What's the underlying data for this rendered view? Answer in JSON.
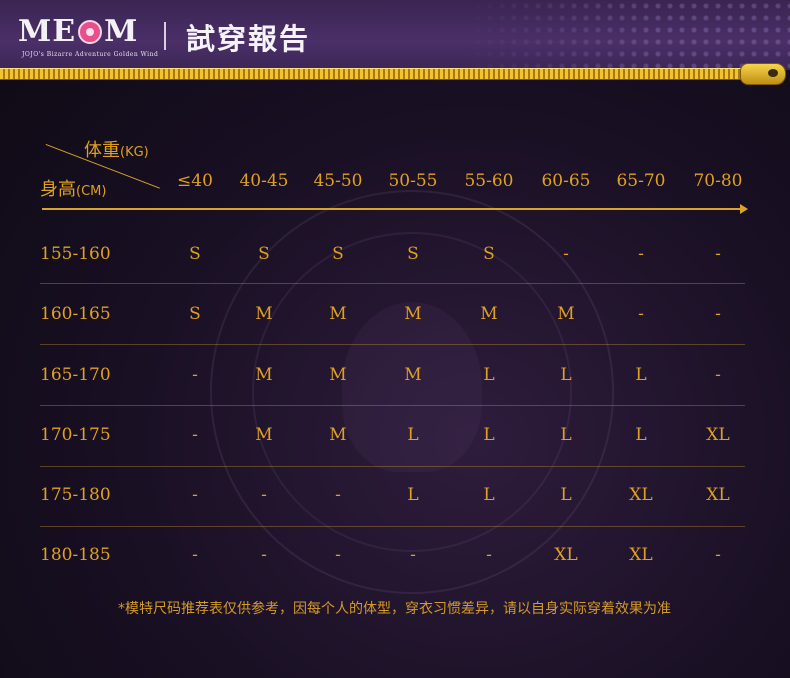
{
  "header": {
    "logo": "MEOM",
    "logo_subtitle": "JOJO's Bizarre Adventure Golden Wind",
    "title": "試穿報告"
  },
  "table": {
    "corner_weight_label": "体重",
    "corner_weight_unit": "(KG)",
    "corner_height_label": "身高",
    "corner_height_unit": "(CM)",
    "columns": [
      "≤40",
      "40-45",
      "45-50",
      "50-55",
      "55-60",
      "60-65",
      "65-70",
      "70-80"
    ],
    "rows": [
      {
        "height": "155-160",
        "sizes": [
          "S",
          "S",
          "S",
          "S",
          "S",
          "-",
          "-",
          "-"
        ]
      },
      {
        "height": "160-165",
        "sizes": [
          "S",
          "M",
          "M",
          "M",
          "M",
          "M",
          "-",
          "-"
        ]
      },
      {
        "height": "165-170",
        "sizes": [
          "-",
          "M",
          "M",
          "M",
          "L",
          "L",
          "L",
          "-"
        ]
      },
      {
        "height": "170-175",
        "sizes": [
          "-",
          "M",
          "M",
          "L",
          "L",
          "L",
          "L",
          "XL"
        ]
      },
      {
        "height": "175-180",
        "sizes": [
          "-",
          "-",
          "-",
          "L",
          "L",
          "L",
          "XL",
          "XL"
        ]
      },
      {
        "height": "180-185",
        "sizes": [
          "-",
          "-",
          "-",
          "-",
          "-",
          "XL",
          "XL",
          "-"
        ]
      }
    ]
  },
  "footnote": "*模特尺码推荐表仅供参考，因每个人的体型，穿衣习惯差异，请以自身实际穿着效果为准",
  "colors": {
    "accent_gold": "#e0a020",
    "header_purple": "#4a2f68",
    "background_dark": "#180f22"
  }
}
